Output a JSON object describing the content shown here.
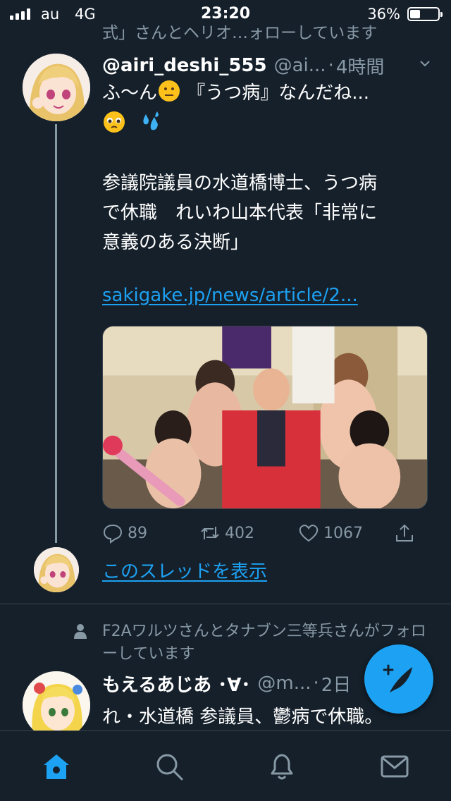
{
  "status_bar": {
    "carrier": "au",
    "network": "4G",
    "time": "23:20",
    "battery_percent": "36%",
    "battery_level": 0.36
  },
  "context_cut_text": "式」さんとヘリオ…ォローしています",
  "tweet1": {
    "display_name": "@airi_deshi_555",
    "handle": "@ai...",
    "separator": "·",
    "time": "4時間",
    "text_line1": "ふ〜ん",
    "text_line1_rest": "『うつ病』なんだね...",
    "body_lines": [
      "参議院議員の水道橋博士、うつ病",
      "で休職　れいわ山本代表「非常に",
      "意義のある決断」"
    ],
    "link": "sakigake.jp/news/article/2...",
    "replies": "89",
    "retweets": "402",
    "likes": "1067",
    "show_thread": "このスレッドを表示"
  },
  "tweet2": {
    "social_context": "F2Aワルツさんとタナブン三等兵さんがフォローしています",
    "display_name": "もえるあじあ ･∀･",
    "handle": "@m...",
    "separator": "·",
    "time": "2日",
    "text": "れ・水道橋 参議員、鬱病で休職。"
  },
  "icons": {
    "tweet_menu": "chevron-down-icon",
    "reply": "reply-icon",
    "retweet": "retweet-icon",
    "like": "heart-icon",
    "share": "share-icon",
    "compose": "compose-tweet-icon",
    "home": "home-icon",
    "search": "search-icon",
    "notifications": "bell-icon",
    "messages": "envelope-icon"
  },
  "colors": {
    "background": "#15202b",
    "accent": "#1da1f2",
    "secondary_text": "#8899a6",
    "divider": "#38444d"
  }
}
